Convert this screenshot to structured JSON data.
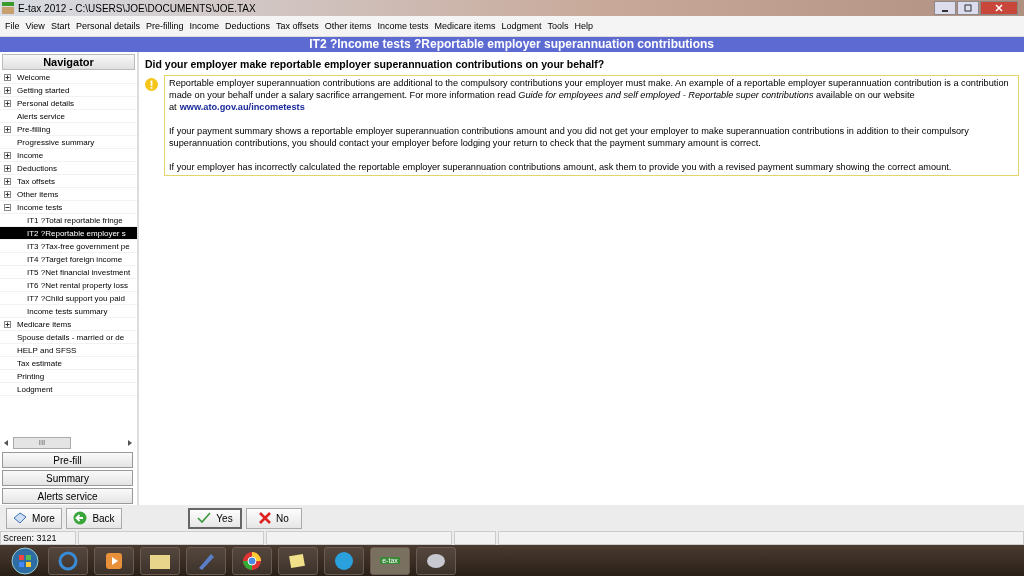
{
  "window": {
    "title": "E-tax 2012 - C:\\USERS\\JOE\\DOCUMENTS\\JOE.TAX"
  },
  "menu": [
    "File",
    "View",
    "Start",
    "Personal details",
    "Pre-filling",
    "Income",
    "Deductions",
    "Tax offsets",
    "Other items",
    "Income tests",
    "Medicare items",
    "Lodgment",
    "Tools",
    "Help"
  ],
  "header": "IT2 ?Income tests ?Reportable employer superannuation contributions",
  "navigator": {
    "title": "Navigator",
    "items": [
      {
        "label": "Welcome",
        "kind": "group",
        "expanded": false,
        "selected": false
      },
      {
        "label": "Getting started",
        "kind": "group",
        "expanded": false,
        "selected": false
      },
      {
        "label": "Personal details",
        "kind": "group",
        "expanded": false,
        "selected": false
      },
      {
        "label": "Alerts service",
        "kind": "leaf",
        "selected": false
      },
      {
        "label": "Pre-filling",
        "kind": "group",
        "expanded": false,
        "selected": false
      },
      {
        "label": "Progressive summary",
        "kind": "leaf",
        "selected": false
      },
      {
        "label": "Income",
        "kind": "group",
        "expanded": false,
        "selected": false
      },
      {
        "label": "Deductions",
        "kind": "group",
        "expanded": false,
        "selected": false
      },
      {
        "label": "Tax offsets",
        "kind": "group",
        "expanded": false,
        "selected": false
      },
      {
        "label": "Other items",
        "kind": "group",
        "expanded": false,
        "selected": false
      },
      {
        "label": "Income tests",
        "kind": "group",
        "expanded": true,
        "selected": false,
        "children": [
          {
            "label": "IT1 ?Total reportable fringe",
            "selected": false
          },
          {
            "label": "IT2 ?Reportable employer s",
            "selected": true
          },
          {
            "label": "IT3 ?Tax-free government pe",
            "selected": false
          },
          {
            "label": "IT4 ?Target foreign income",
            "selected": false
          },
          {
            "label": "IT5 ?Net financial investment",
            "selected": false
          },
          {
            "label": "IT6 ?Net rental property loss",
            "selected": false
          },
          {
            "label": "IT7 ?Child support you paid",
            "selected": false
          },
          {
            "label": "Income tests summary",
            "selected": false
          }
        ]
      },
      {
        "label": "Medicare items",
        "kind": "group",
        "expanded": false,
        "selected": false
      },
      {
        "label": "Spouse details - married or de",
        "kind": "leaf",
        "selected": false
      },
      {
        "label": "HELP and SFSS",
        "kind": "leaf",
        "selected": false
      },
      {
        "label": "Tax estimate",
        "kind": "leaf",
        "selected": false
      },
      {
        "label": "Printing",
        "kind": "leaf",
        "selected": false
      },
      {
        "label": "Lodgment",
        "kind": "leaf",
        "selected": false
      }
    ],
    "scrollbar_thumb": "III",
    "buttons": [
      "Pre-fill",
      "Summary",
      "Alerts service"
    ]
  },
  "question": "Did your employer make reportable employer superannuation contributions on your behalf?",
  "info": [
    {
      "text": "Reportable employer superannuation contributions are additional to the compulsory contributions your employer must make. An example of a reportable employer superannuation contribution is a contribution made on your behalf under a salary sacrifice arrangement. For more information read *Guide for employees and self employed - Reportable super contributions* available on our website at",
      "link": "www.ato.gov.au/incometests"
    },
    {
      "text": "If your payment summary shows a reportable employer superannuation contributions amount and you did not get your employer to make superannuation contributions in addition to their compulsory superannuation contributions, you should contact your employer before lodging your return to check that the payment summary amount is correct."
    },
    {
      "text": "If your employer has incorrectly calculated the reportable employer superannuation contributions amount, ask them to provide you with a revised payment summary showing the correct amount."
    }
  ],
  "actions": [
    {
      "label": "More",
      "kind": "more"
    },
    {
      "label": "Back",
      "kind": "back"
    },
    {
      "label": "Yes",
      "kind": "yes"
    },
    {
      "label": "No",
      "kind": "no"
    }
  ],
  "status_bar": "Screen: 3121",
  "taskbar": {
    "etax_label": "e-tax"
  }
}
